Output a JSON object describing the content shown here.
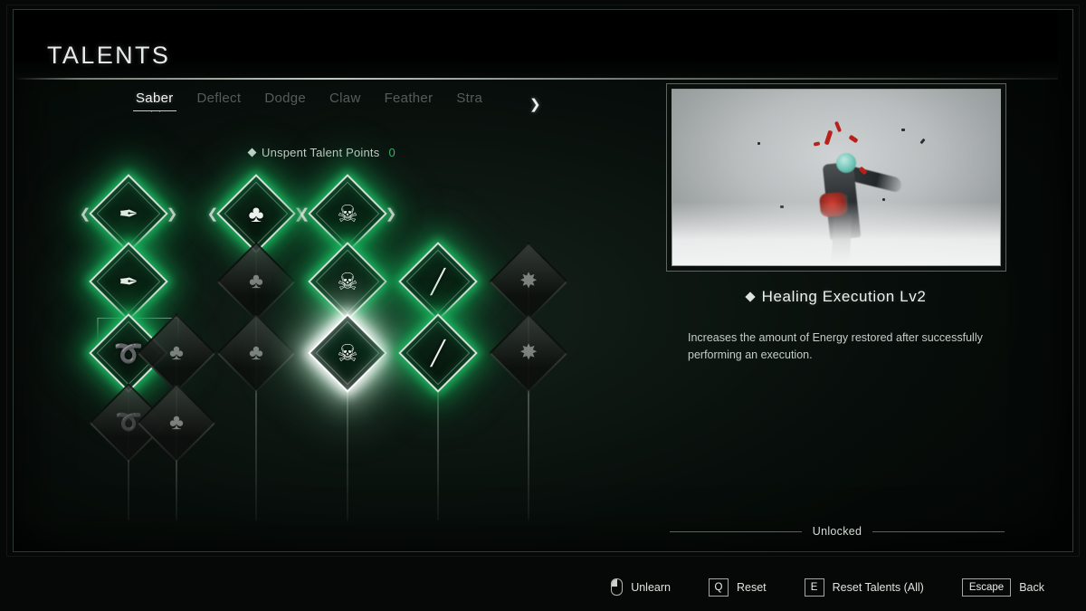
{
  "header": {
    "title": "TALENTS"
  },
  "tabs": {
    "items": [
      {
        "label": "Saber",
        "active": true
      },
      {
        "label": "Deflect",
        "active": false
      },
      {
        "label": "Dodge",
        "active": false
      },
      {
        "label": "Claw",
        "active": false
      },
      {
        "label": "Feather",
        "active": false
      },
      {
        "label": "Stra",
        "active": false
      }
    ],
    "next_arrow": "❯"
  },
  "points": {
    "label": "Unspent Talent Points",
    "value": "0"
  },
  "tree": {
    "columns": [
      {
        "id": "col-1",
        "nodes": [
          {
            "id": "n1-1",
            "state": "unlocked",
            "glyph": "✒",
            "arrows": true
          },
          {
            "id": "n1-2",
            "state": "unlocked",
            "glyph": "✒",
            "arrows": false
          },
          {
            "id": "n1-3",
            "state": "unlocked",
            "glyph": "➰",
            "arrows": false
          },
          {
            "id": "n1-4",
            "state": "locked",
            "glyph": "➰",
            "arrows": false
          }
        ]
      },
      {
        "id": "col-1b",
        "nodes": [
          {
            "id": "n1b-3",
            "state": "locked",
            "glyph": "♣",
            "arrows": false
          },
          {
            "id": "n1b-4",
            "state": "locked",
            "glyph": "♣",
            "arrows": false
          }
        ]
      },
      {
        "id": "col-2",
        "nodes": [
          {
            "id": "n2-1",
            "state": "unlocked",
            "glyph": "♣",
            "arrows": true
          },
          {
            "id": "n2-2",
            "state": "locked",
            "glyph": "♣",
            "arrows": false
          },
          {
            "id": "n2-3",
            "state": "locked",
            "glyph": "♣",
            "arrows": false
          }
        ]
      },
      {
        "id": "col-3",
        "nodes": [
          {
            "id": "n3-1",
            "state": "unlocked",
            "glyph": "☠",
            "arrows": true
          },
          {
            "id": "n3-2",
            "state": "unlocked",
            "glyph": "☠",
            "arrows": false
          },
          {
            "id": "n3-3",
            "state": "selected",
            "glyph": "☠",
            "arrows": false
          }
        ]
      },
      {
        "id": "col-4",
        "nodes": [
          {
            "id": "n4-2",
            "state": "unlocked",
            "glyph": "╱",
            "arrows": false
          },
          {
            "id": "n4-3",
            "state": "unlocked",
            "glyph": "╱",
            "arrows": false
          }
        ]
      },
      {
        "id": "col-5",
        "nodes": [
          {
            "id": "n5-2",
            "state": "locked",
            "glyph": "✸",
            "arrows": false
          },
          {
            "id": "n5-3",
            "state": "locked",
            "glyph": "✸",
            "arrows": false
          }
        ]
      }
    ]
  },
  "detail": {
    "skill_name": "Healing Execution Lv2",
    "description": "Increases the amount of Energy restored after successfully performing an execution.",
    "status": "Unlocked"
  },
  "actions": [
    {
      "key_type": "mouse",
      "key": "",
      "label": "Unlearn"
    },
    {
      "key_type": "key",
      "key": "Q",
      "label": "Reset"
    },
    {
      "key_type": "key",
      "key": "E",
      "label": "Reset Talents (All)"
    },
    {
      "key_type": "key",
      "key": "Escape",
      "label": "Back"
    }
  ],
  "colors": {
    "accent_green": "#1fbe6a",
    "text_primary": "#eef2ee",
    "text_muted": "#c6ccc6",
    "selected_white": "#ffffff"
  }
}
